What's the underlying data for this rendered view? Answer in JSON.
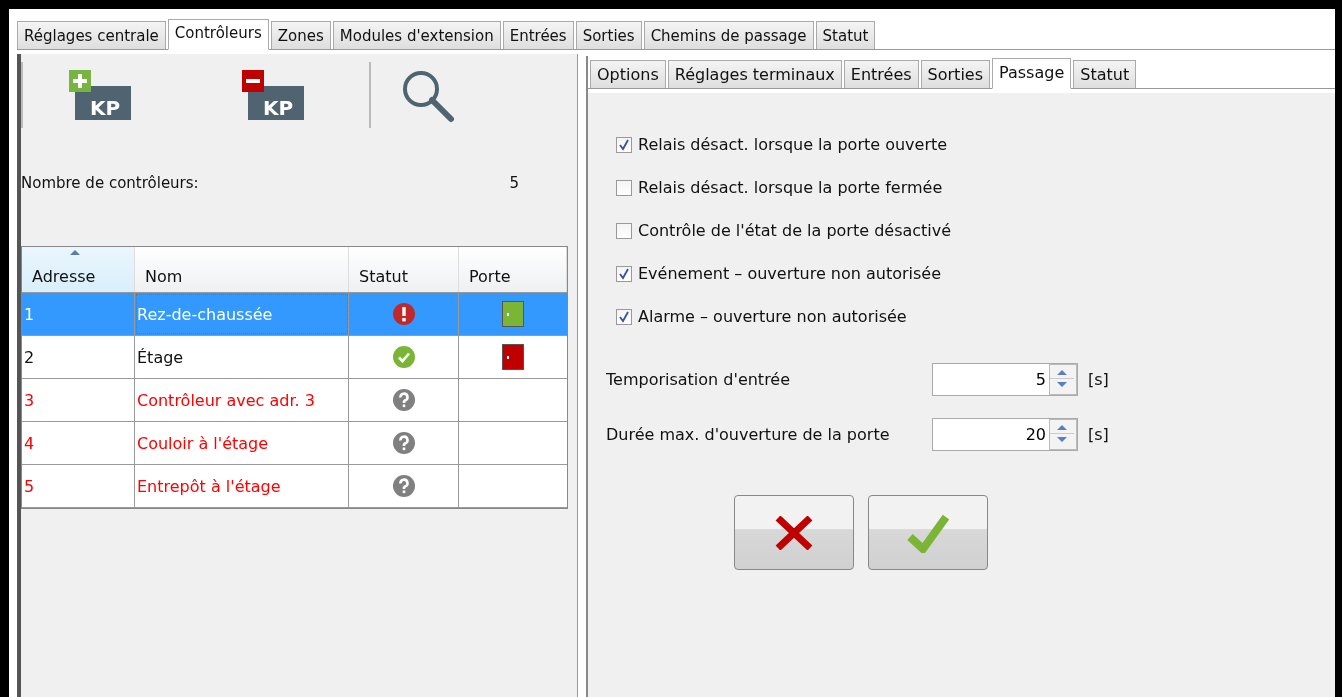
{
  "main_tabs": [
    {
      "label": "Réglages centrale",
      "selected": false
    },
    {
      "label": "Contrôleurs",
      "selected": true
    },
    {
      "label": "Zones",
      "selected": false
    },
    {
      "label": "Modules d'extension",
      "selected": false
    },
    {
      "label": "Entrées",
      "selected": false
    },
    {
      "label": "Sorties",
      "selected": false
    },
    {
      "label": "Chemins de passage",
      "selected": false
    },
    {
      "label": "Statut",
      "selected": false
    }
  ],
  "toolbar": [
    {
      "kind": "add",
      "label": "KP"
    },
    {
      "kind": "remove",
      "label": "KP"
    },
    {
      "kind": "search"
    }
  ],
  "controller_count": {
    "label": "Nombre de contrôleurs:",
    "value": "5"
  },
  "table": {
    "columns": [
      {
        "label": "Adresse",
        "sorted": true
      },
      {
        "label": "Nom",
        "sorted": false
      },
      {
        "label": "Statut",
        "sorted": false
      },
      {
        "label": "Porte",
        "sorted": false
      }
    ],
    "rows": [
      {
        "address": "1",
        "name": "Rez-de-chaussée",
        "status": {
          "kind": "alarm"
        },
        "door": {
          "kind": "open"
        },
        "selected": true,
        "offline": false
      },
      {
        "address": "2",
        "name": "Étage",
        "status": {
          "kind": "ok"
        },
        "door": {
          "kind": "closed"
        },
        "selected": false,
        "offline": false
      },
      {
        "address": "3",
        "name": "Contrôleur avec adr. 3",
        "status": {
          "kind": "unknown"
        },
        "selected": false,
        "offline": true
      },
      {
        "address": "4",
        "name": "Couloir à l'étage",
        "status": {
          "kind": "unknown"
        },
        "selected": false,
        "offline": true
      },
      {
        "address": "5",
        "name": "Entrepôt à l'étage",
        "status": {
          "kind": "unknown"
        },
        "selected": false,
        "offline": true
      }
    ]
  },
  "detail_tabs": [
    {
      "label": "Options",
      "selected": false
    },
    {
      "label": "Réglages terminaux",
      "selected": false
    },
    {
      "label": "Entrées",
      "selected": false
    },
    {
      "label": "Sorties",
      "selected": false
    },
    {
      "label": "Passage",
      "selected": true
    },
    {
      "label": "Statut",
      "selected": false
    }
  ],
  "options": [
    {
      "label": "Relais désact. lorsque la porte ouverte",
      "checked": true
    },
    {
      "label": "Relais désact. lorsque la porte fermée",
      "checked": false
    },
    {
      "label": "Contrôle de l'état de la porte désactivé",
      "checked": false
    },
    {
      "label": "Evénement – ouverture non autorisée",
      "checked": true
    },
    {
      "label": "Alarme – ouverture non autorisée",
      "checked": true
    }
  ],
  "spinners": [
    {
      "label": "Temporisation d'entrée",
      "value": "5",
      "unit": "[s]"
    },
    {
      "label": "Durée max. d'ouverture de la porte",
      "value": "20",
      "unit": "[s]"
    }
  ],
  "actions": [
    {
      "kind": "cancel"
    },
    {
      "kind": "confirm"
    }
  ]
}
